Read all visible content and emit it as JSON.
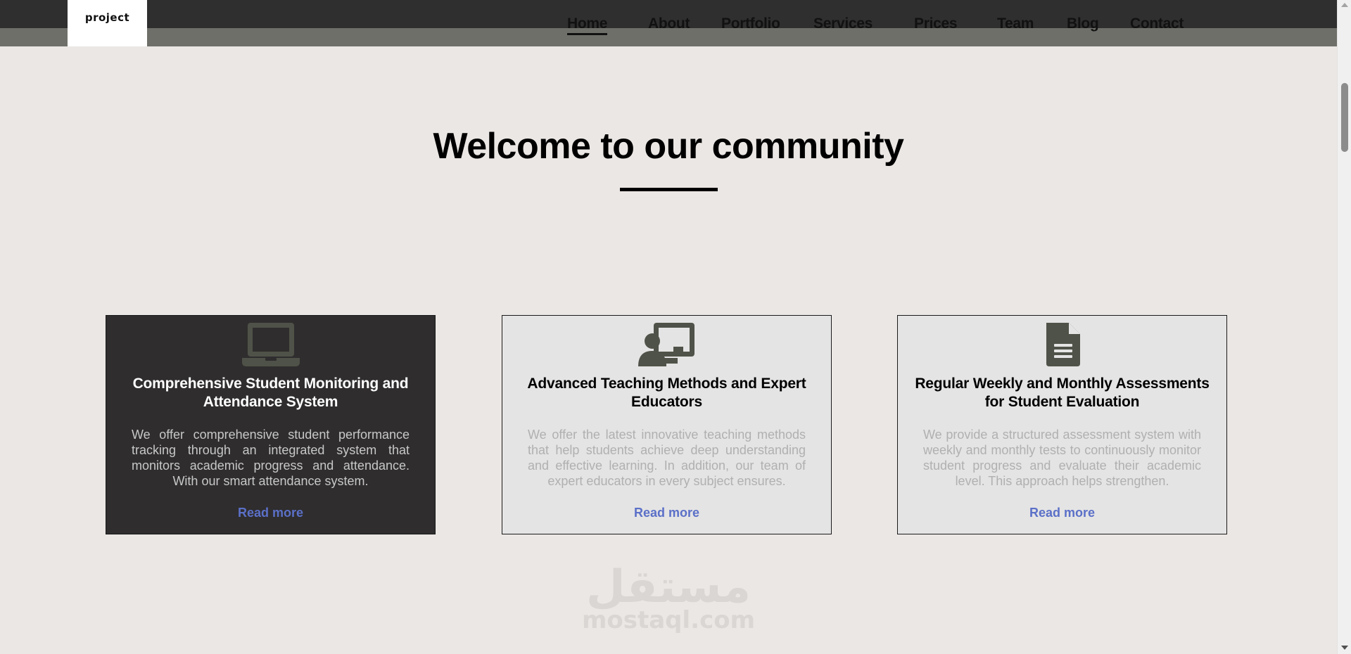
{
  "header": {
    "logo_text": "project",
    "nav": [
      {
        "label": "Home",
        "active": true
      },
      {
        "label": "About",
        "active": false
      },
      {
        "label": "Portfolio",
        "active": false
      },
      {
        "label": "Services",
        "active": false
      },
      {
        "label": "Prices",
        "active": false
      },
      {
        "label": "Team",
        "active": false
      },
      {
        "label": "Blog",
        "active": false
      },
      {
        "label": "Contact",
        "active": false
      }
    ]
  },
  "hero": {
    "title": "Welcome to our community"
  },
  "cards": [
    {
      "icon": "laptop-icon",
      "title": "Comprehensive Student Monitoring and Attendance System",
      "text": "We offer comprehensive student performance tracking through an integrated system that monitors academic progress and attendance. With our smart attendance system.",
      "link": "Read more"
    },
    {
      "icon": "teacher-board-icon",
      "title": "Advanced Teaching Methods and Expert Educators",
      "text": "We offer the latest innovative teaching methods that help students achieve deep understanding and effective learning. In addition, our team of expert educators in every subject ensures.",
      "link": "Read more"
    },
    {
      "icon": "document-icon",
      "title": "Regular Weekly and Monthly Assessments for Student Evaluation",
      "text": "We provide a structured assessment system with weekly and monthly tests to continuously monitor student progress and evaluate their academic level. This approach helps strengthen.",
      "link": "Read more"
    }
  ],
  "watermark": {
    "arabic": "مستقل",
    "latin": "mostaql.com"
  },
  "colors": {
    "page_bg": "#ebe7e4",
    "header_dark": "#2f2f2f",
    "header_band": "#6f6f6a",
    "card_dark": "#2f2d2e",
    "card_light": "#e4e4e4",
    "icon": "#4f5248",
    "link": "#5b70c8"
  }
}
